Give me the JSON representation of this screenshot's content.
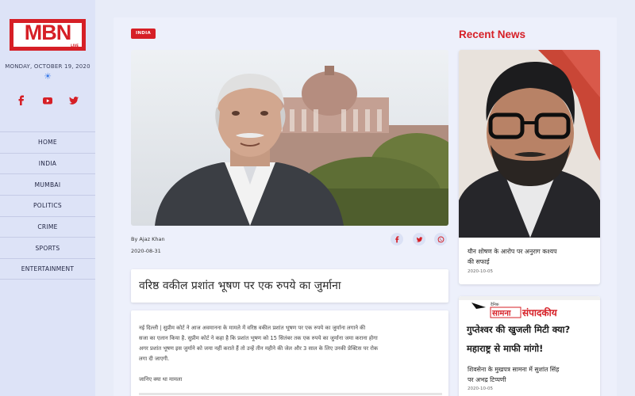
{
  "brand": {
    "logo": "MBN",
    "logo_sub": "LIVE"
  },
  "date": "MONDAY, OCTOBER 19, 2020",
  "social": [
    "facebook-icon",
    "youtube-icon",
    "twitter-icon"
  ],
  "nav": [
    {
      "label": "HOME"
    },
    {
      "label": "INDIA"
    },
    {
      "label": "MUMBAI"
    },
    {
      "label": "POLITICS"
    },
    {
      "label": "CRIME"
    },
    {
      "label": "SPORTS"
    },
    {
      "label": "ENTERTAINMENT"
    }
  ],
  "article": {
    "category": "INDIA",
    "author": "By Ajaz Khan",
    "date": "2020-08-31",
    "headline": "वरिष्ठ वकील प्रशांत भूषण पर एक रुपये का जुर्माना",
    "body_lines": [
      "नई दिल्ली |   सुप्रीम कोर्ट ने आज अवमानना के मामले में वरिष्ठ वकील प्रशांत भूषण पर एक रुपये का जुर्माना लगाने की",
      "सजा का एलान किया है. सुप्रीम कोर्ट ने कहा है कि प्रशांत भूषण को 15 सितंबर तक एक रुपये का जुर्माना जमा कराना होगा",
      "अगर प्रशांत भूषण इस जुर्माने को जमा नहीं कराते हैं तो उन्हें तीन महीने की जेल और 3 साल के लिए उनकी प्रेक्टिस पर रोक",
      "लगा दी जाएगी."
    ],
    "subheading": "जानिए क्या था मामला"
  },
  "recent": {
    "title": "Recent News",
    "items": [
      {
        "title_lines": [
          "यौन शोषण के आरोप पर अनुराग कश्यप",
          "की सफाई"
        ],
        "date": "2020-10-05"
      },
      {
        "title_lines": [
          "शिवसेना के मुखपत्र सामना में सुशांत सिंह",
          "पर अभद्र टिप्पणी"
        ],
        "date": "2020-10-05",
        "image_text": {
          "brand": "सामना",
          "column": "संपादकीय",
          "line1": "गुप्तेश्वर की खुजली मिटी क्या?",
          "line2": "महाराष्ट्र से माफी मांगो!"
        }
      }
    ]
  },
  "colors": {
    "accent": "#d61f26",
    "sidebar": "#dde3f7",
    "background": "#e8ecf8"
  }
}
